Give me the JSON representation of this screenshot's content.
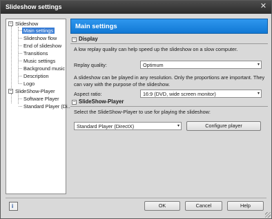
{
  "window": {
    "title": "Slideshow settings",
    "close_glyph": "✕"
  },
  "tree": {
    "items": [
      {
        "label": "Slideshow",
        "toggle": "−"
      },
      {
        "label": "Main settings"
      },
      {
        "label": "Slideshow flow"
      },
      {
        "label": "End of slideshow"
      },
      {
        "label": "Transitions"
      },
      {
        "label": "Music settings"
      },
      {
        "label": "Background music"
      },
      {
        "label": "Description"
      },
      {
        "label": "Logo"
      },
      {
        "label": "SlideShow-Player",
        "toggle": "−"
      },
      {
        "label": "Software Player"
      },
      {
        "label": "Standard Player (Di..."
      }
    ]
  },
  "panel": {
    "header": "Main settings",
    "display": {
      "section_label": "Display",
      "toggle": "−",
      "hint": "A low replay quality can help speed up the slideshow on a slow computer.",
      "replay_label": "Replay quality:",
      "replay_value": "Optimum",
      "aspect_hint_1": "A slideshow can be played in any resolution. Only the proportions are important. They",
      "aspect_hint_2": "can vary with the purpose of the slideshow.",
      "aspect_label": "Aspect ratio:",
      "aspect_value": "16:9 (DVD, wide screen monitor)"
    },
    "player": {
      "section_label": "SlideShow-Player",
      "toggle": "−",
      "hint": "Select the SlideShow-Player to use for playing the slideshow:",
      "player_value": "Standard Player (DirectX)",
      "configure_label": "Configure player"
    }
  },
  "footer": {
    "ok_label": "OK",
    "cancel_label": "Cancel",
    "help_label": "Help",
    "help_icon_glyph": "i"
  },
  "icons": {
    "dropdown": "▾"
  },
  "colors": {
    "accent": "#1a82dc",
    "selection": "#3a7ed6"
  }
}
